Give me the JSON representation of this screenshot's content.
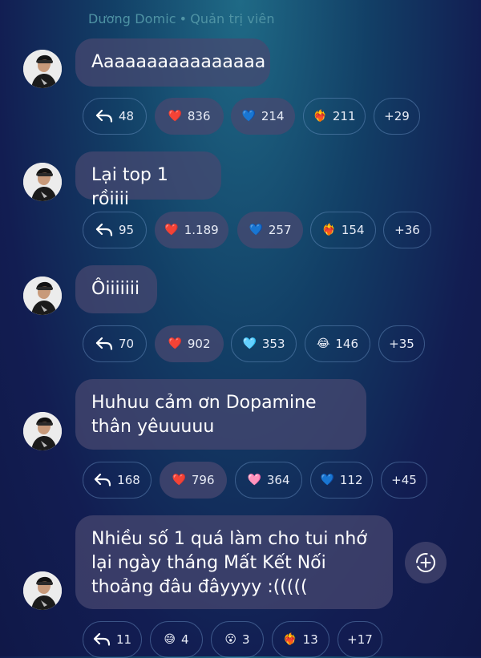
{
  "sender": {
    "name": "Dương Domic",
    "separator": "•",
    "role": "Quản trị viên"
  },
  "messages": [
    {
      "text": "Aaaaaaaaaaaaaaaa",
      "replies": "48",
      "reactions": [
        {
          "icon": "red-heart",
          "emoji": "❤️",
          "count": "836"
        },
        {
          "icon": "blue-heart",
          "emoji": "💙",
          "count": "214"
        },
        {
          "icon": "heart-on-fire",
          "emoji": "❤️‍🔥",
          "count": "211"
        }
      ],
      "more": "+29"
    },
    {
      "text": "Lại top 1 rồiiii",
      "replies": "95",
      "reactions": [
        {
          "icon": "red-heart",
          "emoji": "❤️",
          "count": "1.189"
        },
        {
          "icon": "blue-heart",
          "emoji": "💙",
          "count": "257"
        },
        {
          "icon": "heart-on-fire",
          "emoji": "❤️‍🔥",
          "count": "154"
        }
      ],
      "more": "+36"
    },
    {
      "text": "Ôiiiiiii",
      "replies": "70",
      "reactions": [
        {
          "icon": "red-heart",
          "emoji": "❤️",
          "count": "902"
        },
        {
          "icon": "light-blue-heart",
          "emoji": "🩵",
          "count": "353"
        },
        {
          "icon": "tears-of-joy",
          "emoji": "😂",
          "count": "146"
        }
      ],
      "more": "+35"
    },
    {
      "text": "Huhuu cảm ơn Dopamine thân yêuuuuu",
      "replies": "168",
      "reactions": [
        {
          "icon": "red-heart",
          "emoji": "❤️",
          "count": "796"
        },
        {
          "icon": "pink-heart",
          "emoji": "🩷",
          "count": "364"
        },
        {
          "icon": "blue-heart",
          "emoji": "💙",
          "count": "112"
        }
      ],
      "more": "+45"
    },
    {
      "text": "Nhiều số 1 quá làm cho tui nhớ lại ngày tháng Mất Kết Nối thoảng đâu đâyyyy :(((((",
      "replies": "11",
      "reactions": [
        {
          "icon": "grinning-sweat",
          "emoji": "😅",
          "count": "4"
        },
        {
          "icon": "surprised-face",
          "emoji": "😮",
          "count": "3"
        },
        {
          "icon": "heart-on-fire",
          "emoji": "❤️‍🔥",
          "count": "13"
        }
      ],
      "more": "+17"
    }
  ],
  "colors": {
    "background_top": "#1f6a86",
    "background_bottom": "#121d52",
    "bubble": "#484870",
    "header": "#4f93a4"
  }
}
